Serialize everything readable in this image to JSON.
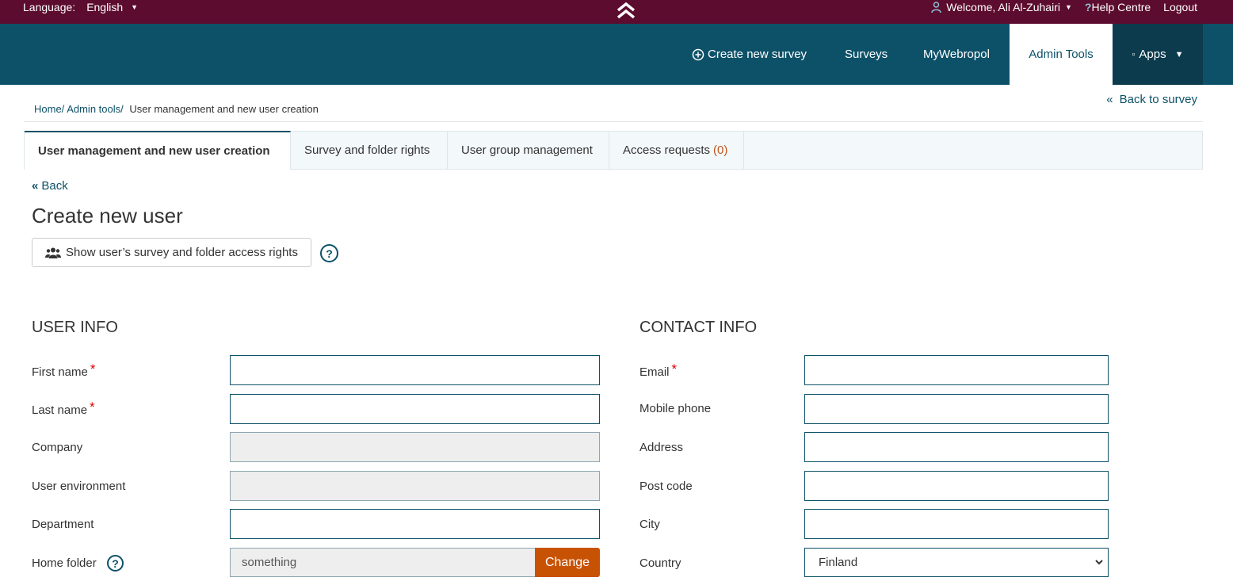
{
  "topbar": {
    "language_label": "Language:",
    "language_value": "English",
    "welcome": "Welcome, Ali Al-Zuhairi",
    "help": "Help Centre",
    "logout": "Logout"
  },
  "nav": {
    "create": "Create new survey",
    "surveys": "Surveys",
    "mywebropol": "MyWebropol",
    "admin": "Admin Tools",
    "apps": "Apps"
  },
  "breadcrumb": {
    "home": "Home/",
    "admin": "Admin tools/",
    "current": "User management and new user creation"
  },
  "back_to_survey": "Back to survey",
  "tabs": [
    {
      "label": "User management and new user creation"
    },
    {
      "label": "Survey and folder rights"
    },
    {
      "label": "User group management"
    },
    {
      "label": "Access requests",
      "count": "(0)"
    }
  ],
  "back": "Back",
  "page_title": "Create new user",
  "show_rights_button": "Show user’s survey and folder access rights",
  "user_info": {
    "heading": "USER INFO",
    "first_name": "First name",
    "last_name": "Last name",
    "company": "Company",
    "user_environment": "User environment",
    "department": "Department",
    "home_folder": "Home folder",
    "home_folder_value": "something",
    "change_button": "Change"
  },
  "contact_info": {
    "heading": "CONTACT INFO",
    "email": "Email",
    "mobile": "Mobile phone",
    "address": "Address",
    "post_code": "Post code",
    "city": "City",
    "country": "Country",
    "country_value": "Finland"
  },
  "required_mark": "*",
  "help_mark": "?",
  "colors": {
    "topbar": "#5c0c2e",
    "navbar": "#0d5168",
    "accent_button": "#c85204"
  }
}
